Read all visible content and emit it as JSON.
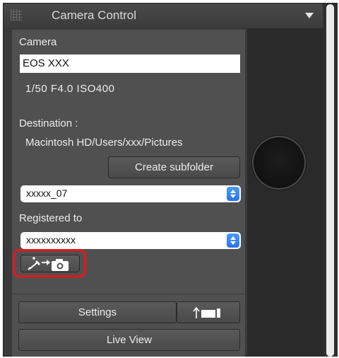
{
  "panel": {
    "title": "Camera Control"
  },
  "camera": {
    "label": "Camera",
    "model": "EOS XXX",
    "settings_readout": "1/50  F4.0  ISO400"
  },
  "destination": {
    "label": "Destination :",
    "path": "Macintosh HD/Users/xxx/Pictures",
    "create_subfolder_label": "Create subfolder",
    "subfolder_value": "xxxxx_07"
  },
  "registered": {
    "label": "Registered to",
    "value": "xxxxxxxxxx"
  },
  "buttons": {
    "settings_label": "Settings",
    "live_view_label": "Live View"
  },
  "icons": {
    "grip": "grip-icon",
    "collapse": "triangle-down-icon",
    "dropper_camera": "eyedropper-to-camera-icon",
    "upload": "upload-to-camera-icon"
  },
  "colors": {
    "highlight": "#e8141d",
    "stepper_accent": "#2b74e0"
  }
}
